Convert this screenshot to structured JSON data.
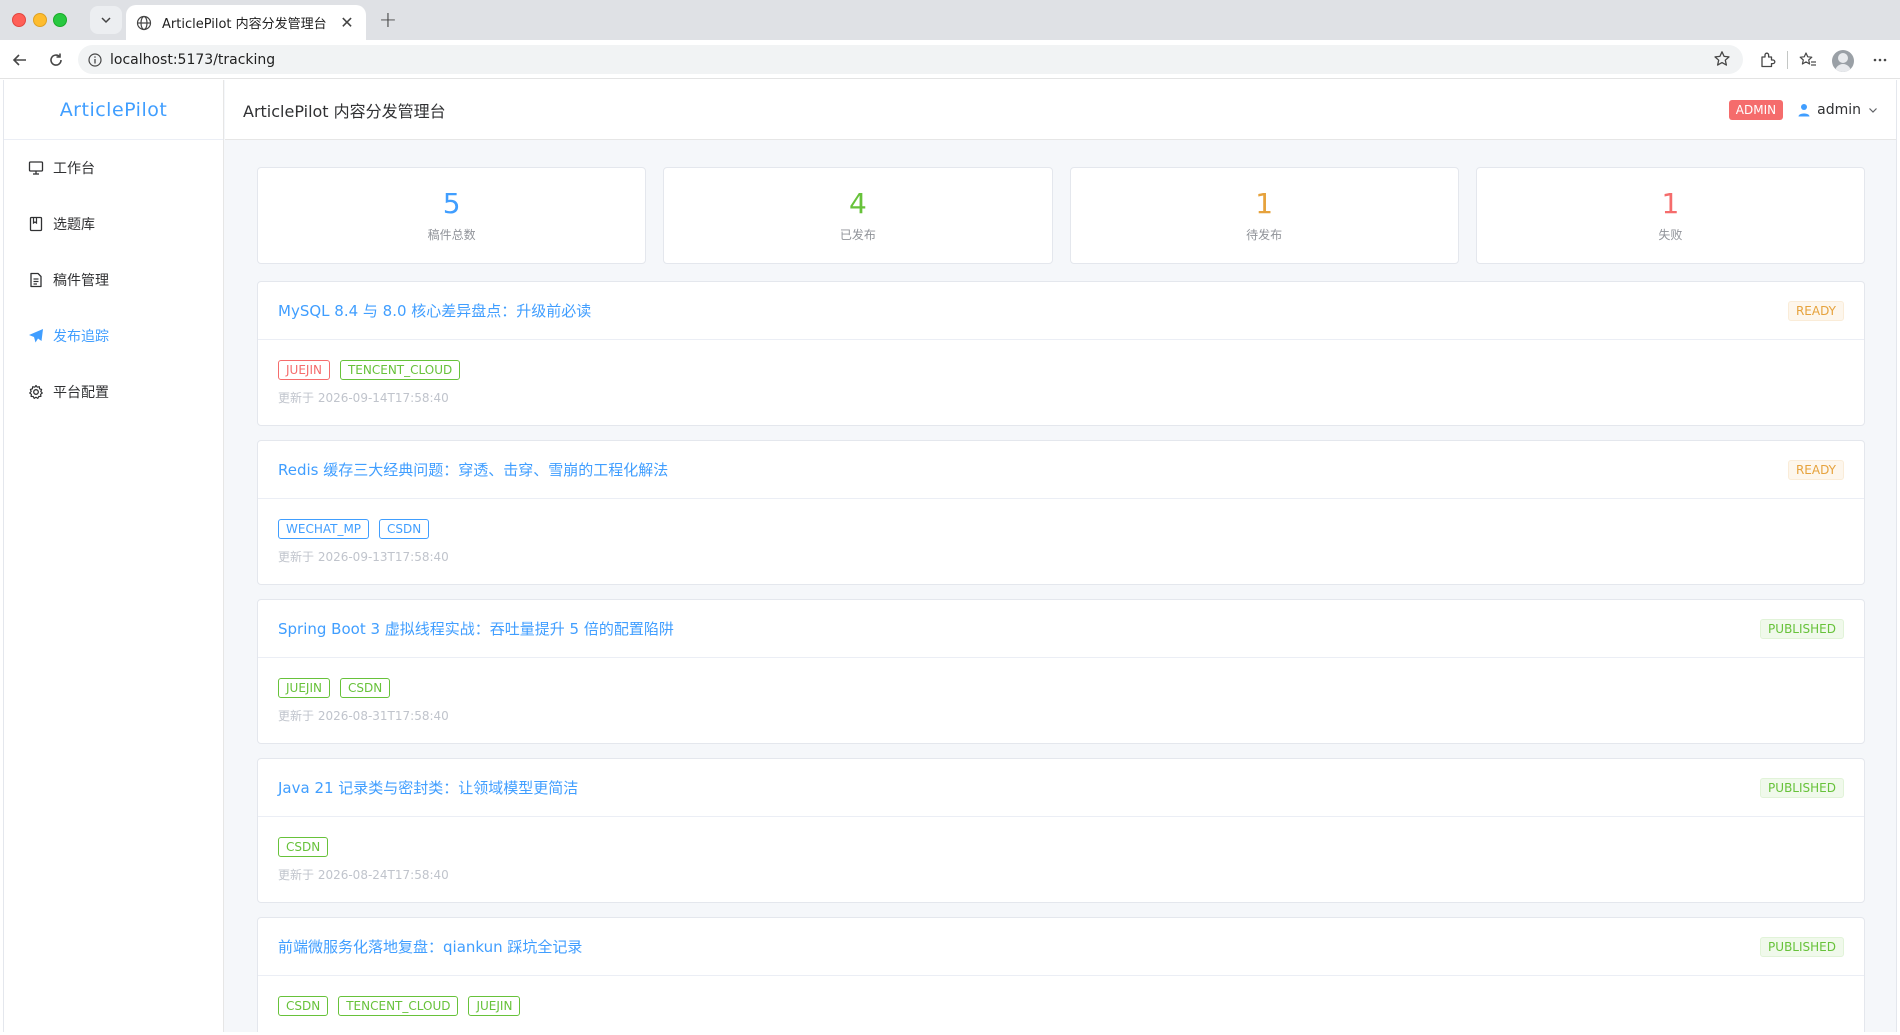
{
  "browser": {
    "tab_title": "ArticlePilot 内容分发管理台",
    "url": "localhost:5173/tracking"
  },
  "app": {
    "logo": "ArticlePilot",
    "header_title": "ArticlePilot 内容分发管理台",
    "role_badge": "ADMIN",
    "username": "admin"
  },
  "sidebar": {
    "items": [
      {
        "label": "工作台",
        "icon": "monitor-icon",
        "active": false
      },
      {
        "label": "选题库",
        "icon": "notebook-icon",
        "active": false
      },
      {
        "label": "稿件管理",
        "icon": "document-icon",
        "active": false
      },
      {
        "label": "发布追踪",
        "icon": "paper-plane-icon",
        "active": true
      },
      {
        "label": "平台配置",
        "icon": "gear-icon",
        "active": false
      }
    ]
  },
  "stats": [
    {
      "value": "5",
      "label": "稿件总数",
      "color": "#409eff"
    },
    {
      "value": "4",
      "label": "已发布",
      "color": "#67c23a"
    },
    {
      "value": "1",
      "label": "待发布",
      "color": "#e6a23c"
    },
    {
      "value": "1",
      "label": "失败",
      "color": "#f56c6c"
    }
  ],
  "articles": [
    {
      "title": "MySQL 8.4 与 8.0 核心差异盘点：升级前必读",
      "status": "READY",
      "tags": [
        {
          "label": "JUEJIN",
          "color": "red"
        },
        {
          "label": "TENCENT_CLOUD",
          "color": "green"
        }
      ],
      "updated": "更新于 2026-09-14T17:58:40"
    },
    {
      "title": "Redis 缓存三大经典问题：穿透、击穿、雪崩的工程化解法",
      "status": "READY",
      "tags": [
        {
          "label": "WECHAT_MP",
          "color": "blue"
        },
        {
          "label": "CSDN",
          "color": "blue"
        }
      ],
      "updated": "更新于 2026-09-13T17:58:40"
    },
    {
      "title": "Spring Boot 3 虚拟线程实战：吞吐量提升 5 倍的配置陷阱",
      "status": "PUBLISHED",
      "tags": [
        {
          "label": "JUEJIN",
          "color": "green"
        },
        {
          "label": "CSDN",
          "color": "green"
        }
      ],
      "updated": "更新于 2026-08-31T17:58:40"
    },
    {
      "title": "Java 21 记录类与密封类：让领域模型更简洁",
      "status": "PUBLISHED",
      "tags": [
        {
          "label": "CSDN",
          "color": "green"
        }
      ],
      "updated": "更新于 2026-08-24T17:58:40"
    },
    {
      "title": "前端微服务化落地复盘：qiankun 踩坑全记录",
      "status": "PUBLISHED",
      "tags": [
        {
          "label": "CSDN",
          "color": "green"
        },
        {
          "label": "TENCENT_CLOUD",
          "color": "green"
        },
        {
          "label": "JUEJIN",
          "color": "green"
        }
      ],
      "updated": ""
    }
  ]
}
